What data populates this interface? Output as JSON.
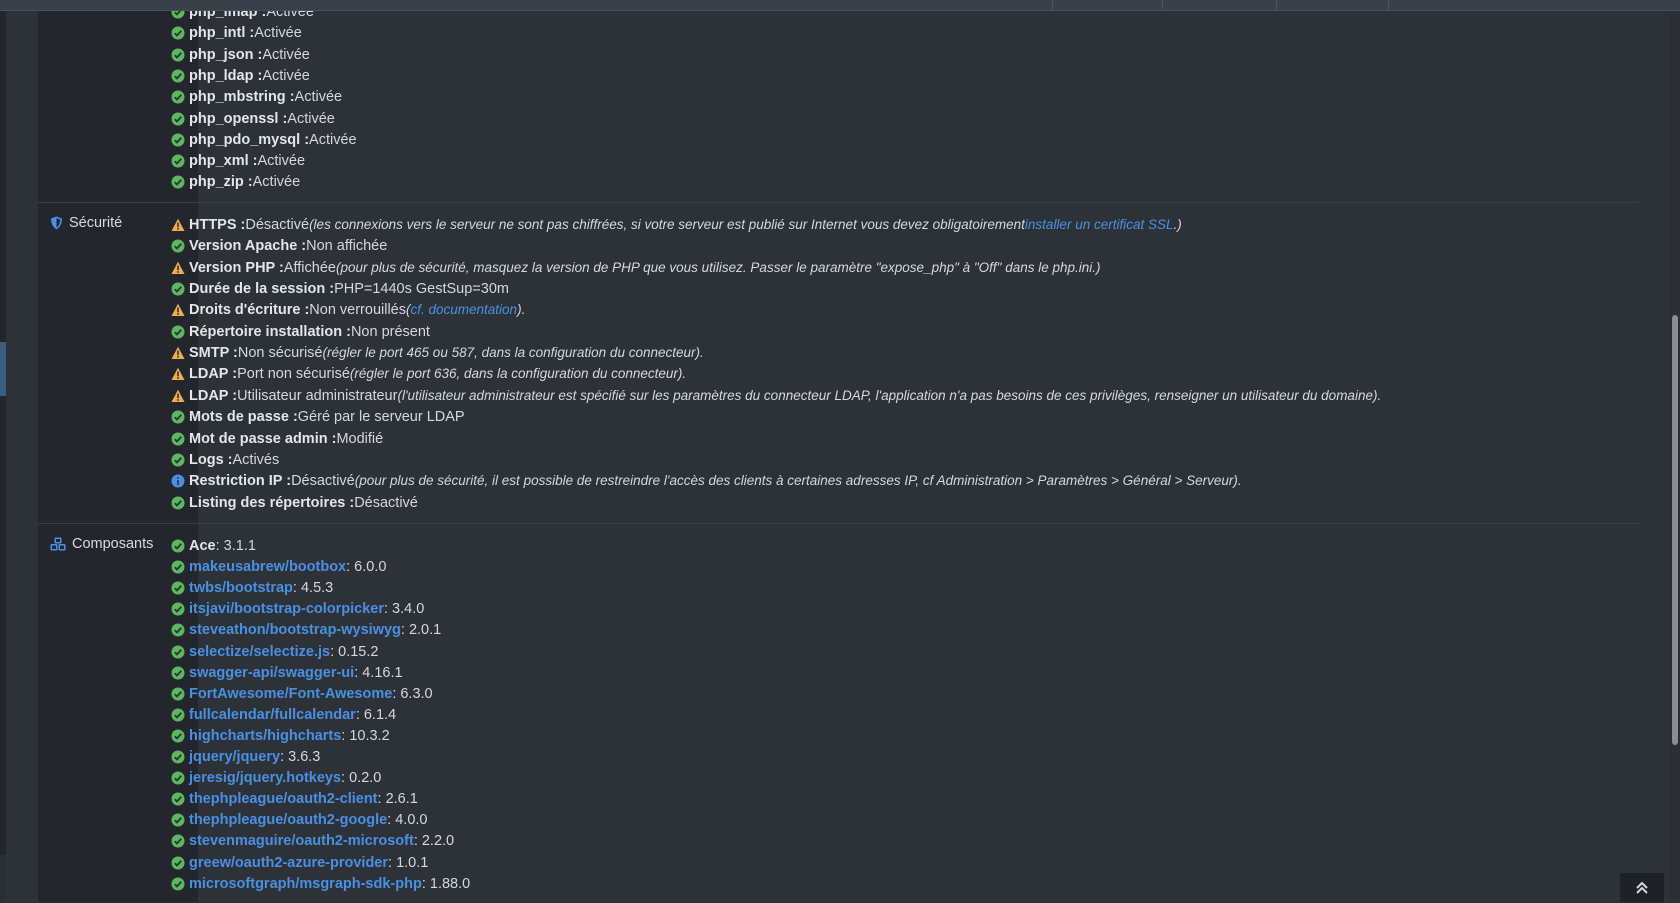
{
  "colors": {
    "ok": "#5cb85c",
    "warn": "#f0ad4e",
    "info": "#4a90e2",
    "link": "#4a90e2"
  },
  "extensions": [
    {
      "key": "php_imap :",
      "value": " Activée",
      "status": "ok"
    },
    {
      "key": "php_intl :",
      "value": " Activée",
      "status": "ok"
    },
    {
      "key": "php_json :",
      "value": " Activée",
      "status": "ok"
    },
    {
      "key": "php_ldap :",
      "value": " Activée",
      "status": "ok"
    },
    {
      "key": "php_mbstring :",
      "value": " Activée",
      "status": "ok"
    },
    {
      "key": "php_openssl :",
      "value": " Activée",
      "status": "ok"
    },
    {
      "key": "php_pdo_mysql :",
      "value": " Activée",
      "status": "ok"
    },
    {
      "key": "php_xml :",
      "value": " Activée",
      "status": "ok"
    },
    {
      "key": "php_zip :",
      "value": " Activée",
      "status": "ok"
    }
  ],
  "security": {
    "label": "Sécurité",
    "icon": "shield-icon",
    "items": [
      {
        "status": "warn",
        "key": "HTTPS :",
        "value": " Désactivé ",
        "note": "(les connexions vers le serveur ne sont pas chiffrées, si votre serveur est publié sur Internet vous devez obligatoirement ",
        "link": "installer un certificat SSL",
        "note_end": ".)"
      },
      {
        "status": "ok",
        "key": "Version Apache :",
        "value": " Non affichée",
        "note": "",
        "link": "",
        "note_end": ""
      },
      {
        "status": "warn",
        "key": "Version PHP :",
        "value": " Affichée ",
        "note": "(pour plus de sécurité, masquez la version de PHP que vous utilisez. Passer le paramètre \"expose_php\" à \"Off\" dans le php.ini.)",
        "link": "",
        "note_end": ""
      },
      {
        "status": "ok",
        "key": "Durée de la session :",
        "value": " PHP=1440s GestSup=30m",
        "note": "",
        "link": "",
        "note_end": ""
      },
      {
        "status": "warn",
        "key": "Droits d'écriture :",
        "value": " Non verrouillés ",
        "note": "(",
        "link": "cf. documentation",
        "note_end": ")."
      },
      {
        "status": "ok",
        "key": "Répertoire installation :",
        "value": " Non présent",
        "note": "",
        "link": "",
        "note_end": ""
      },
      {
        "status": "warn",
        "key": "SMTP :",
        "value": " Non sécurisé ",
        "note": "(régler le port 465 ou 587, dans la configuration du connecteur).",
        "link": "",
        "note_end": ""
      },
      {
        "status": "warn",
        "key": "LDAP :",
        "value": " Port non sécurisé ",
        "note": "(régler le port 636, dans la configuration du connecteur).",
        "link": "",
        "note_end": ""
      },
      {
        "status": "warn",
        "key": "LDAP :",
        "value": " Utilisateur administrateur ",
        "note": "(l'utilisateur administrateur est spécifié sur les paramètres du connecteur LDAP, l'application n'a pas besoins de ces privilèges, renseigner un utilisateur du domaine).",
        "link": "",
        "note_end": ""
      },
      {
        "status": "ok",
        "key": "Mots de passe :",
        "value": " Géré par le serveur LDAP",
        "note": "",
        "link": "",
        "note_end": ""
      },
      {
        "status": "ok",
        "key": "Mot de passe admin :",
        "value": " Modifié",
        "note": "",
        "link": "",
        "note_end": ""
      },
      {
        "status": "ok",
        "key": "Logs :",
        "value": " Activés",
        "note": "",
        "link": "",
        "note_end": ""
      },
      {
        "status": "info",
        "key": "Restriction IP :",
        "value": " Désactivé ",
        "note": "(pour plus de sécurité, il est possible de restreindre l'accès des clients à certaines adresses IP, cf Administration > Paramètres > Général > Serveur).",
        "link": "",
        "note_end": ""
      },
      {
        "status": "ok",
        "key": "Listing des répertoires :",
        "value": " Désactivé",
        "note": "",
        "link": "",
        "note_end": ""
      }
    ]
  },
  "components": {
    "label": "Composants",
    "icon": "cubes-icon",
    "items": [
      {
        "name": "Ace",
        "link": false,
        "version": " : 3.1.1"
      },
      {
        "name": "makeusabrew/bootbox",
        "link": true,
        "version": " : 6.0.0"
      },
      {
        "name": "twbs/bootstrap",
        "link": true,
        "version": " : 4.5.3"
      },
      {
        "name": "itsjavi/bootstrap-colorpicker",
        "link": true,
        "version": " : 3.4.0"
      },
      {
        "name": "steveathon/bootstrap-wysiwyg",
        "link": true,
        "version": " : 2.0.1"
      },
      {
        "name": "selectize/selectize.js",
        "link": true,
        "version": " : 0.15.2"
      },
      {
        "name": "swagger-api/swagger-ui",
        "link": true,
        "version": " : 4.16.1"
      },
      {
        "name": "FortAwesome/Font-Awesome",
        "link": true,
        "version": " : 6.3.0"
      },
      {
        "name": "fullcalendar/fullcalendar",
        "link": true,
        "version": " : 6.1.4"
      },
      {
        "name": "highcharts/highcharts",
        "link": true,
        "version": " : 10.3.2"
      },
      {
        "name": "jquery/jquery",
        "link": true,
        "version": " : 3.6.3"
      },
      {
        "name": "jeresig/jquery.hotkeys",
        "link": true,
        "version": " : 0.2.0"
      },
      {
        "name": "thephpleague/oauth2-client",
        "link": true,
        "version": " : 2.6.1"
      },
      {
        "name": "thephpleague/oauth2-google",
        "link": true,
        "version": " : 4.0.0"
      },
      {
        "name": "stevenmaguire/oauth2-microsoft",
        "link": true,
        "version": " : 2.2.0"
      },
      {
        "name": "greew/oauth2-azure-provider",
        "link": true,
        "version": " : 1.0.1"
      },
      {
        "name": "microsoftgraph/msgraph-sdk-php",
        "link": true,
        "version": " : 1.88.0"
      }
    ]
  },
  "back_to_top_icon": "chevron-double-up-icon"
}
